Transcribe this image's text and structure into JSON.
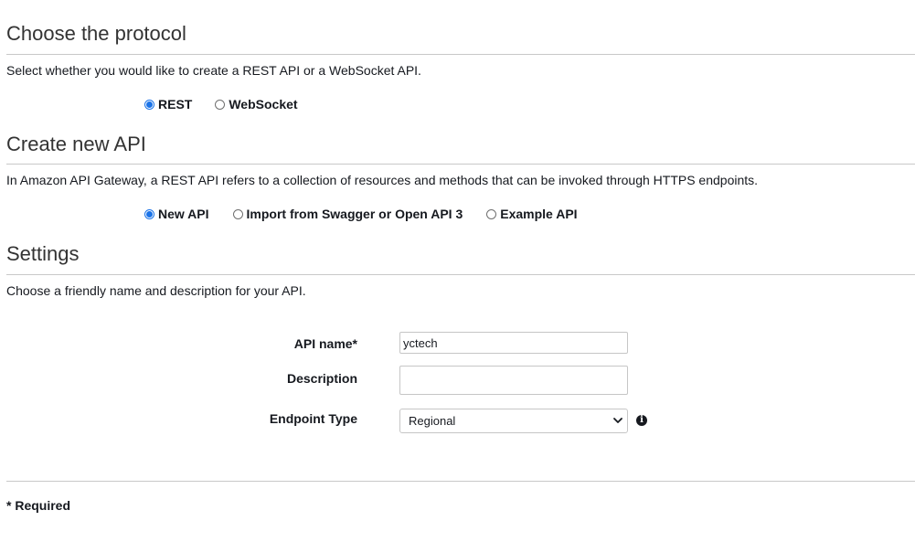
{
  "protocol": {
    "title": "Choose the protocol",
    "description": "Select whether you would like to create a REST API or a WebSocket API.",
    "options": [
      {
        "label": "REST",
        "checked": true
      },
      {
        "label": "WebSocket",
        "checked": false
      }
    ]
  },
  "create_api": {
    "title": "Create new API",
    "description": "In Amazon API Gateway, a REST API refers to a collection of resources and methods that can be invoked through HTTPS endpoints.",
    "options": [
      {
        "label": "New API",
        "checked": true
      },
      {
        "label": "Import from Swagger or Open API 3",
        "checked": false
      },
      {
        "label": "Example API",
        "checked": false
      }
    ]
  },
  "settings": {
    "title": "Settings",
    "description": "Choose a friendly name and description for your API.",
    "api_name": {
      "label": "API name*",
      "value": "yctech",
      "placeholder": ""
    },
    "description_field": {
      "label": "Description",
      "value": "",
      "placeholder": ""
    },
    "endpoint_type": {
      "label": "Endpoint Type",
      "value": "Regional",
      "info_icon": "info-icon"
    }
  },
  "footer": {
    "required_note": "* Required"
  },
  "colors": {
    "radio_accent": "#1a73e8",
    "divider": "#c8c8c8"
  }
}
